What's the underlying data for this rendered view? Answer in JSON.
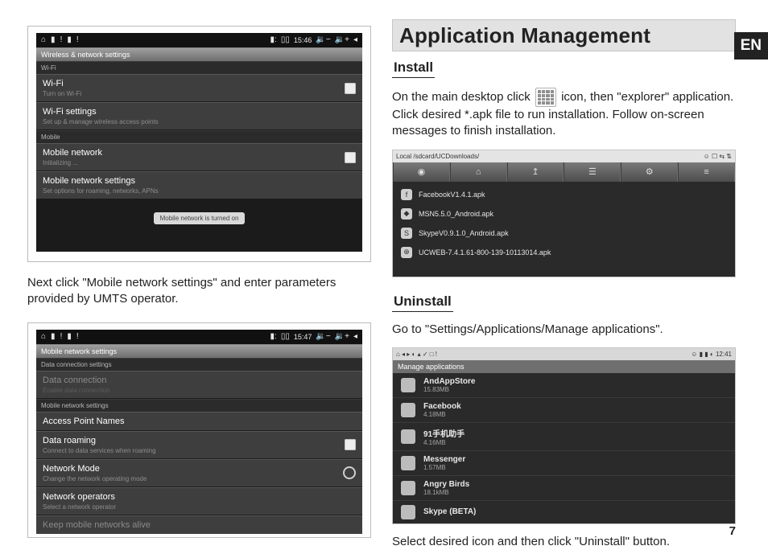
{
  "lang_tab": "EN",
  "page_number": "7",
  "left": {
    "para1": "Next click \"Mobile network settings\" and enter parameters provided by UMTS operator.",
    "shot1": {
      "time": "15:46",
      "title": "Wireless & network settings",
      "wifi_head": "Wi-Fi",
      "rows": [
        {
          "label": "Wi-Fi",
          "sub": "Turn on Wi-Fi",
          "accessory": "check"
        },
        {
          "label": "Wi-Fi settings",
          "sub": "Set up & manage wireless access points"
        }
      ],
      "mobile_head": "Mobile",
      "m_rows": [
        {
          "label": "Mobile network",
          "sub": "Initializing ...",
          "accessory": "check"
        },
        {
          "label": "Mobile network settings",
          "sub": "Set options for roaming, networks, APNs"
        }
      ],
      "toast": "Mobile network is turned on"
    },
    "shot2": {
      "time": "15:47",
      "title": "Mobile network settings",
      "head1": "Data connection settings",
      "r1": {
        "label": "Data connection",
        "sub": "Enable data connection"
      },
      "head2": "Mobile network settings",
      "r2": {
        "label": "Access Point Names"
      },
      "r3": {
        "label": "Data roaming",
        "sub": "Connect to data services when roaming",
        "accessory": "check"
      },
      "r4": {
        "label": "Network Mode",
        "sub": "Change the network operating mode",
        "accessory": "radio"
      },
      "r5": {
        "label": "Network operators",
        "sub": "Select a network operator"
      },
      "r6": {
        "label": "Keep mobile networks alive"
      }
    }
  },
  "right": {
    "heading": "Application Management",
    "install_title": "Install",
    "install_para1": "On the main desktop click ",
    "install_para2": " icon, then \"explorer\" application. Click desired *.apk file to run installation. Follow on-screen messages to finish installation.",
    "uninstall_title": "Uninstall",
    "uninstall_para1": "Go to \"Settings/Applications/Manage applications\".",
    "uninstall_para2": "Select desired icon and then click \"Uninstall\" button.",
    "fe": {
      "path": "Local  /sdcard/UCDownloads/",
      "right_icons": "☺ ☐ ⇆ ⇅",
      "files": [
        {
          "ico": "f",
          "name": "FacebookV1.4.1.apk"
        },
        {
          "ico": "◆",
          "name": "MSN5.5.0_Android.apk"
        },
        {
          "ico": "S",
          "name": "SkypeV0.9.1.0_Android.apk"
        },
        {
          "ico": "⊕",
          "name": "UCWEB-7.4.1.61-800-139-10113014.apk"
        }
      ]
    },
    "ma": {
      "time": "12:41",
      "bar": "Manage applications",
      "apps": [
        {
          "name": "AndAppStore",
          "size": "15.83MB"
        },
        {
          "name": "Facebook",
          "size": "4.18MB"
        },
        {
          "name": "91手机助手",
          "size": "4.16MB"
        },
        {
          "name": "Messenger",
          "size": "1.57MB"
        },
        {
          "name": "Angry Birds",
          "size": "18.1kMB"
        },
        {
          "name": "Skype (BETA)",
          "size": ""
        }
      ]
    }
  }
}
